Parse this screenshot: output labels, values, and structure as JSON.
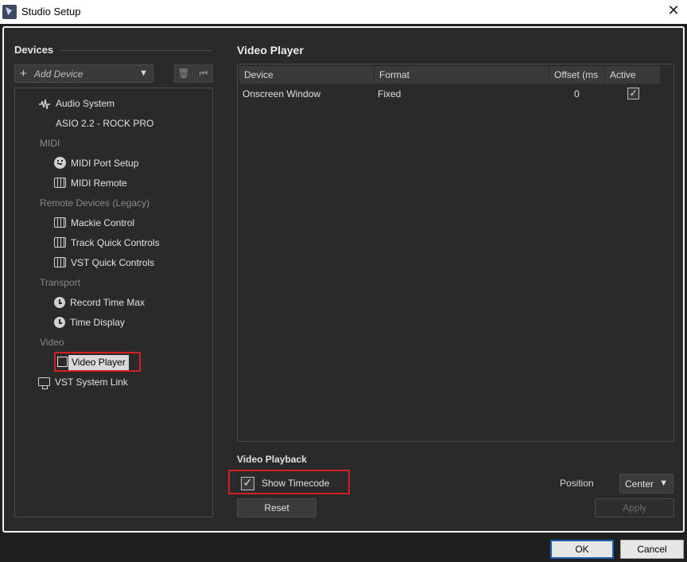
{
  "window": {
    "title": "Studio Setup",
    "close_glyph": "✕"
  },
  "devices": {
    "title": "Devices",
    "add_device_label": "Add Device",
    "tree": {
      "audio_system": "Audio System",
      "asio": "ASIO 2.2 - ROCK PRO",
      "midi_category": "MIDI",
      "midi_port_setup": "MIDI Port Setup",
      "midi_remote": "MIDI Remote",
      "remote_category": "Remote Devices (Legacy)",
      "mackie": "Mackie Control",
      "track_quick": "Track Quick Controls",
      "vst_quick": "VST Quick Controls",
      "transport_category": "Transport",
      "record_time_max": "Record Time Max",
      "time_display": "Time Display",
      "video_category": "Video",
      "video_player": "Video Player",
      "vst_system_link": "VST System Link"
    }
  },
  "video_player": {
    "title": "Video Player",
    "table": {
      "headers": {
        "device": "Device",
        "format": "Format",
        "offset": "Offset (ms",
        "active": "Active"
      },
      "rows": [
        {
          "device": "Onscreen Window",
          "format": "Fixed",
          "offset": "0",
          "active": "✓"
        }
      ]
    }
  },
  "playback": {
    "title": "Video Playback",
    "show_timecode_label": "Show Timecode",
    "show_timecode_check": "✓",
    "position_label": "Position",
    "position_value": "Center",
    "reset_label": "Reset",
    "apply_label": "Apply"
  },
  "footer": {
    "ok_label": "OK",
    "cancel_label": "Cancel"
  }
}
